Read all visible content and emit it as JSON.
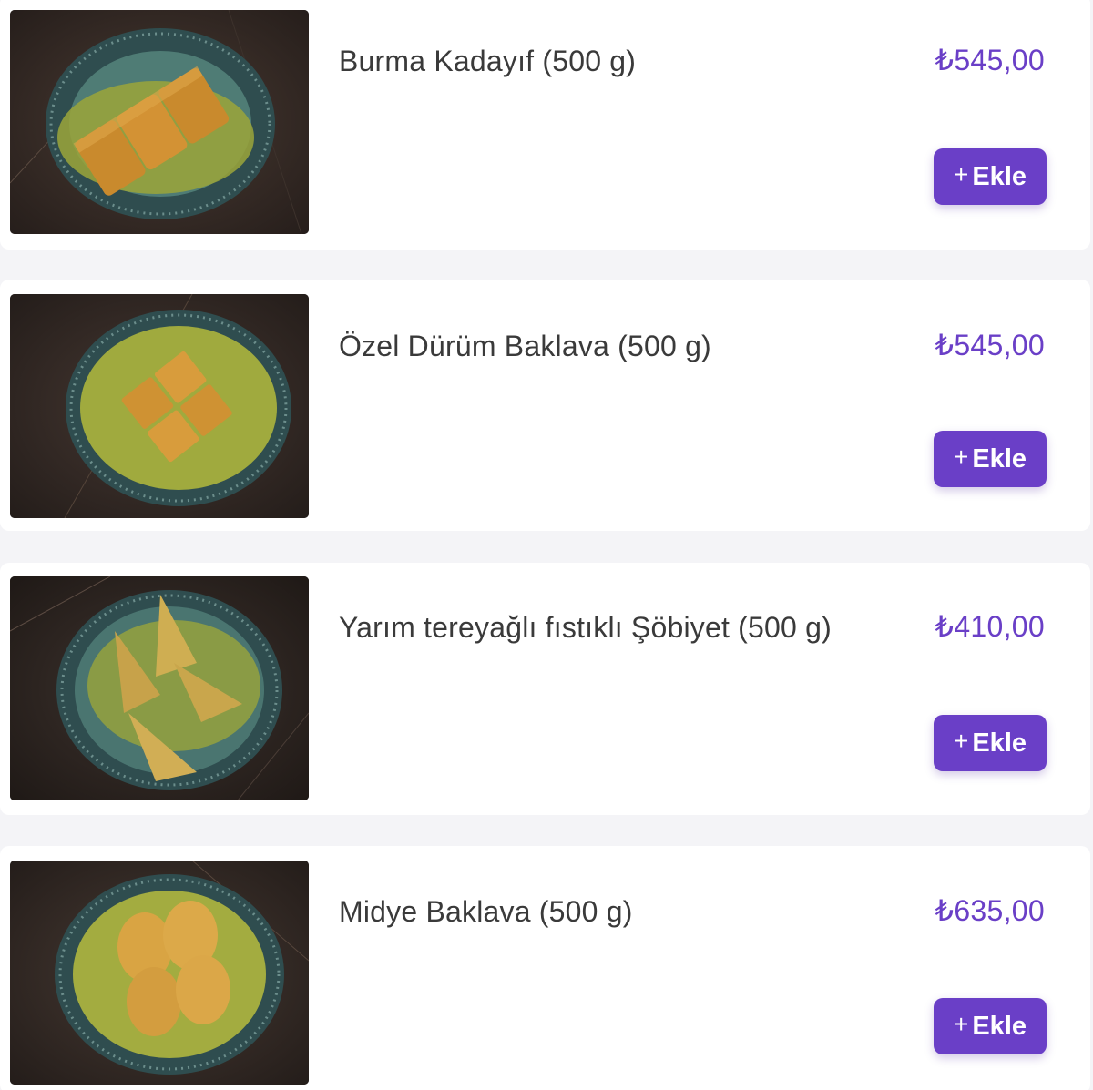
{
  "colors": {
    "accent": "#6a3fc7",
    "card_bg": "#ffffff",
    "page_bg": "#f4f4f7",
    "name_text": "#3a3a3a"
  },
  "products": [
    {
      "name": "Burma Kadayıf (500 g)",
      "price": "₺545,00",
      "add_icon": "+",
      "add_label": "Ekle",
      "image_alt": "Burma kadayıf on a teal plate with pistachio"
    },
    {
      "name": "Özel Dürüm Baklava (500 g)",
      "price": "₺545,00",
      "add_icon": "+",
      "add_label": "Ekle",
      "image_alt": "Özel dürüm baklava squares on a teal plate"
    },
    {
      "name": "Yarım tereyağlı fıstıklı Şöbiyet (500 g)",
      "price": "₺410,00",
      "add_icon": "+",
      "add_label": "Ekle",
      "image_alt": "Şöbiyet triangles with pistachio on a teal plate"
    },
    {
      "name": "Midye Baklava (500 g)",
      "price": "₺635,00",
      "add_icon": "+",
      "add_label": "Ekle",
      "image_alt": "Midye baklava shells on a teal plate"
    }
  ]
}
